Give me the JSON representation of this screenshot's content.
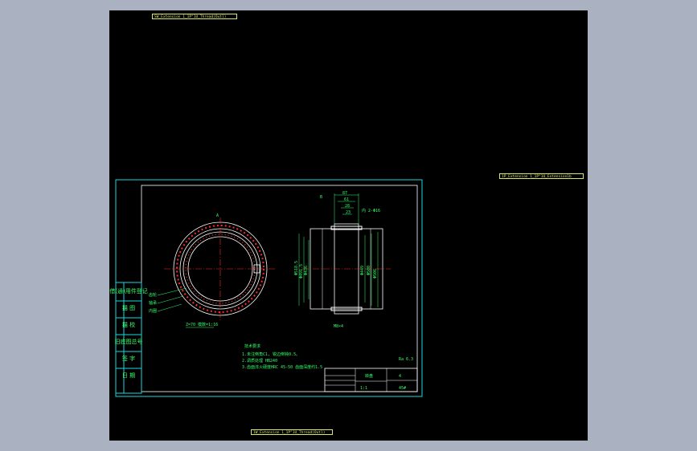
{
  "tags": {
    "top": "SW_Extension 1_1P\"1U_Thread(Outl)",
    "right": "1P_Extension 1_1P\"1U_Extension1b",
    "bottom": "1W_Extension 1_1P\"1U_Thread(Outl)"
  },
  "sidebar": {
    "labels": [
      "借(通)用件登记",
      "描 图",
      "描 校",
      "旧底图总号",
      "签 字",
      "日 期"
    ]
  },
  "drawing": {
    "view_label": "A",
    "section_label": "B",
    "callouts": [
      "齿轮",
      "轴承",
      "内圈"
    ],
    "tooth_note": "Z=70 模数=1:16",
    "dims_left": [
      "Φ518.5",
      "Φ491.5",
      "Φ436"
    ],
    "dims_right": [
      "Φ449",
      "Φ500",
      "Φ506"
    ],
    "top_dims": [
      "87",
      "61",
      "28",
      "23",
      "内 2-Φ16"
    ],
    "bottom_note": "M8×4",
    "roughness": "Ra 6.3",
    "notes_title": "技术要求",
    "notes": [
      "1.未注倒角C1, 锐边倒钝0.5。",
      "2.调质处理 HB240",
      "3.齿面淬火硬度HRC 45-50 齿面深度约1.5"
    ]
  },
  "title_block": {
    "name": "转盘",
    "scale": "1:1",
    "number": "4",
    "code": "45#"
  }
}
